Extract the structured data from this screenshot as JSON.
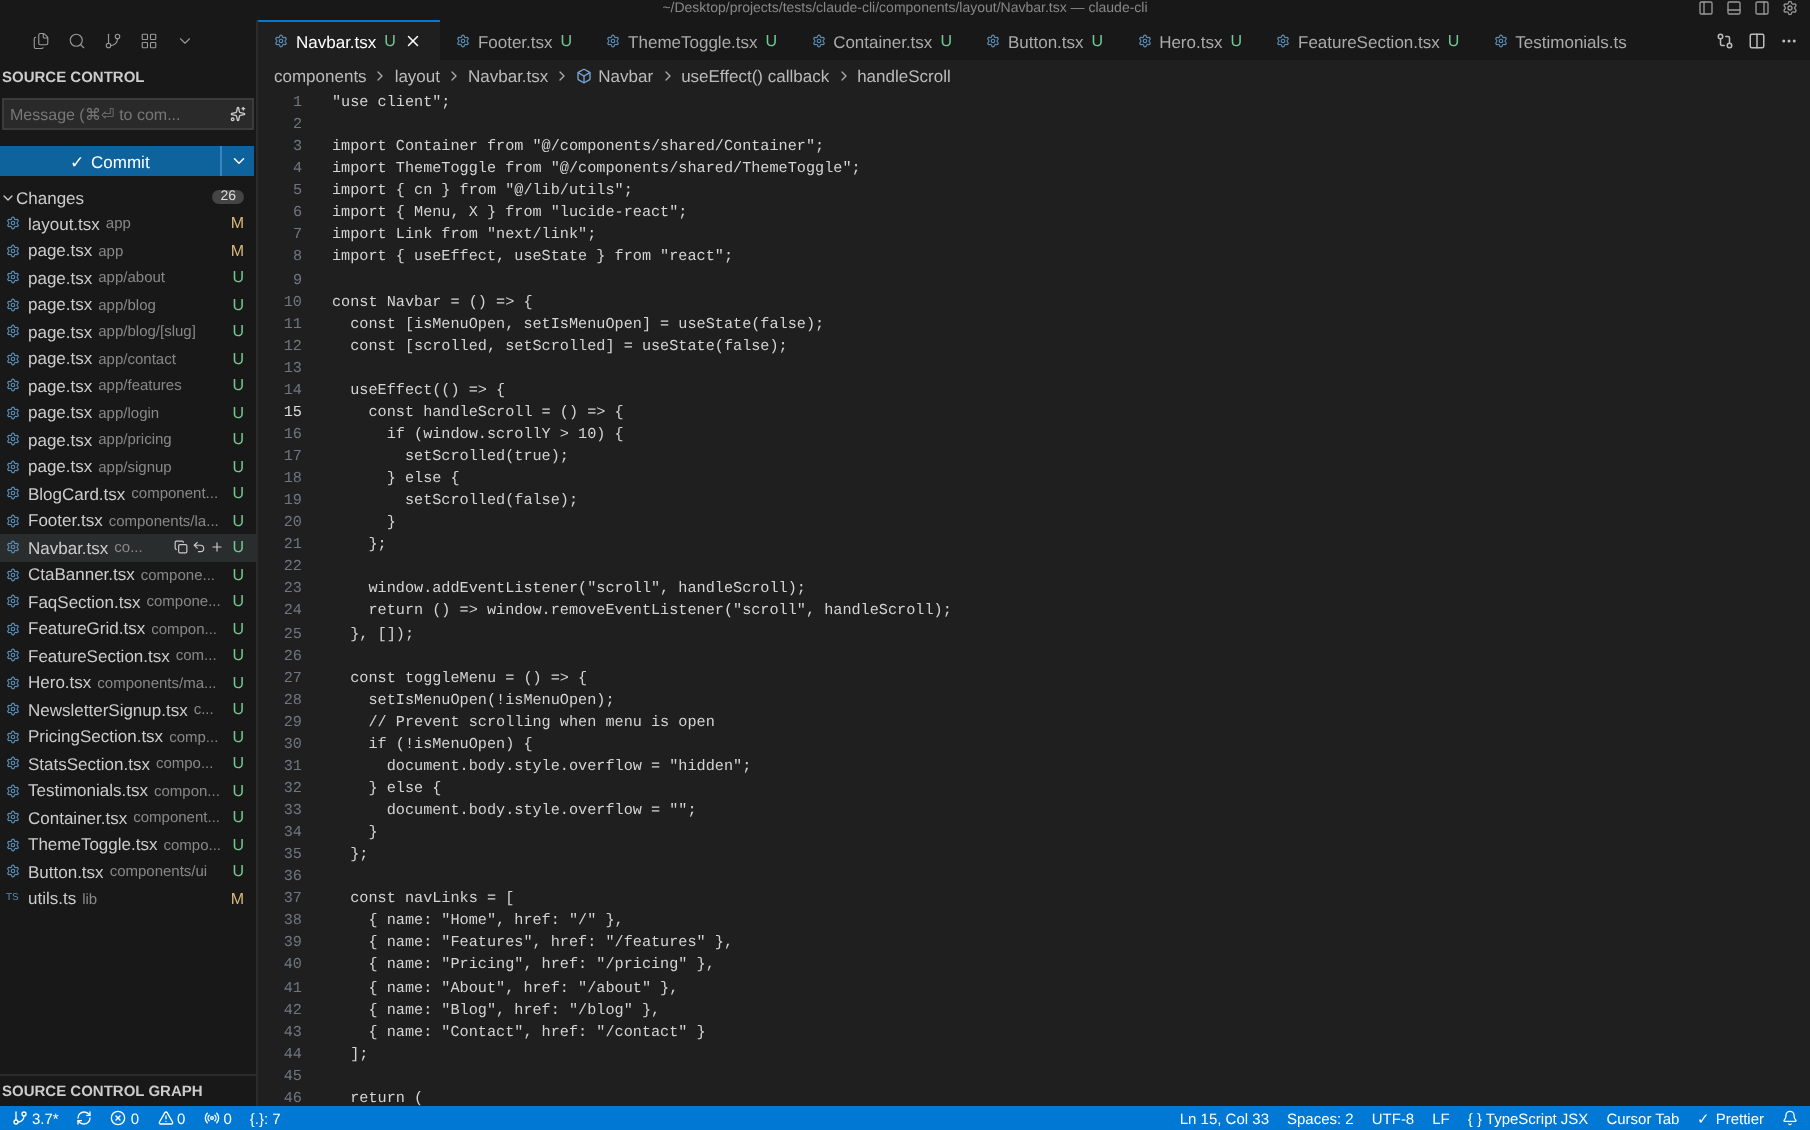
{
  "window": {
    "title": "~/Desktop/projects/tests/claude-cli/components/layout/Navbar.tsx — claude-cli"
  },
  "sidebar": {
    "title": "SOURCE CONTROL",
    "message": {
      "placeholder": "Message (⌘⏎ to com..."
    },
    "commit": "✓ Commit",
    "changes": {
      "label": "Changes",
      "count": "26",
      "expanded": true
    },
    "files": [
      {
        "name": "layout.tsx",
        "path": "app",
        "status": "M",
        "selected": false
      },
      {
        "name": "page.tsx",
        "path": "app",
        "status": "M",
        "selected": false
      },
      {
        "name": "page.tsx",
        "path": "app/about",
        "status": "U",
        "selected": false
      },
      {
        "name": "page.tsx",
        "path": "app/blog",
        "status": "U",
        "selected": false
      },
      {
        "name": "page.tsx",
        "path": "app/blog/[slug]",
        "status": "U",
        "selected": false
      },
      {
        "name": "page.tsx",
        "path": "app/contact",
        "status": "U",
        "selected": false
      },
      {
        "name": "page.tsx",
        "path": "app/features",
        "status": "U",
        "selected": false
      },
      {
        "name": "page.tsx",
        "path": "app/login",
        "status": "U",
        "selected": false
      },
      {
        "name": "page.tsx",
        "path": "app/pricing",
        "status": "U",
        "selected": false
      },
      {
        "name": "page.tsx",
        "path": "app/signup",
        "status": "U",
        "selected": false
      },
      {
        "name": "BlogCard.tsx",
        "path": "component...",
        "status": "U",
        "selected": false
      },
      {
        "name": "Footer.tsx",
        "path": "components/la...",
        "status": "U",
        "selected": false
      },
      {
        "name": "Navbar.tsx",
        "path": "co...",
        "status": "U",
        "selected": true
      },
      {
        "name": "CtaBanner.tsx",
        "path": "compone...",
        "status": "U",
        "selected": false
      },
      {
        "name": "FaqSection.tsx",
        "path": "compone...",
        "status": "U",
        "selected": false
      },
      {
        "name": "FeatureGrid.tsx",
        "path": "compon...",
        "status": "U",
        "selected": false
      },
      {
        "name": "FeatureSection.tsx",
        "path": "com...",
        "status": "U",
        "selected": false
      },
      {
        "name": "Hero.tsx",
        "path": "components/ma...",
        "status": "U",
        "selected": false
      },
      {
        "name": "NewsletterSignup.tsx",
        "path": "c...",
        "status": "U",
        "selected": false
      },
      {
        "name": "PricingSection.tsx",
        "path": "comp...",
        "status": "U",
        "selected": false
      },
      {
        "name": "StatsSection.tsx",
        "path": "compo...",
        "status": "U",
        "selected": false
      },
      {
        "name": "Testimonials.tsx",
        "path": "compon...",
        "status": "U",
        "selected": false
      },
      {
        "name": "Container.tsx",
        "path": "component...",
        "status": "U",
        "selected": false
      },
      {
        "name": "ThemeToggle.tsx",
        "path": "compo...",
        "status": "U",
        "selected": false
      },
      {
        "name": "Button.tsx",
        "path": "components/ui",
        "status": "U",
        "selected": false
      },
      {
        "name": "utils.ts",
        "path": "lib",
        "status": "M",
        "selected": false,
        "badge": "TS"
      }
    ],
    "graph_title": "SOURCE CONTROL GRAPH"
  },
  "tabs": [
    {
      "label": "Navbar.tsx",
      "status": "U",
      "selected": true
    },
    {
      "label": "Footer.tsx",
      "status": "U",
      "selected": false
    },
    {
      "label": "ThemeToggle.tsx",
      "status": "U",
      "selected": false
    },
    {
      "label": "Container.tsx",
      "status": "U",
      "selected": false
    },
    {
      "label": "Button.tsx",
      "status": "U",
      "selected": false
    },
    {
      "label": "Hero.tsx",
      "status": "U",
      "selected": false
    },
    {
      "label": "FeatureSection.tsx",
      "status": "U",
      "selected": false
    },
    {
      "label": "Testimonials.ts",
      "selected": false
    }
  ],
  "breadcrumbs": [
    "components",
    "layout",
    "Navbar.tsx",
    "Navbar",
    "useEffect() callback",
    "handleScroll"
  ],
  "editor": {
    "lines": [
      {
        "number": "1",
        "current": false,
        "text": "\"use client\";"
      },
      {
        "number": "2",
        "current": false
      },
      {
        "number": "3",
        "current": false,
        "text": "import Container from \"@/components/shared/Container\";"
      },
      {
        "number": "4",
        "current": false,
        "text": "import ThemeToggle from \"@/components/shared/ThemeToggle\";"
      },
      {
        "number": "5",
        "current": false,
        "text": "import { cn } from \"@/lib/utils\";"
      },
      {
        "number": "6",
        "current": false,
        "text": "import { Menu, X } from \"lucide-react\";"
      },
      {
        "number": "7",
        "current": false,
        "text": "import Link from \"next/link\";"
      },
      {
        "number": "8",
        "current": false,
        "text": "import { useEffect, useState } from \"react\";"
      },
      {
        "number": "9",
        "current": false
      },
      {
        "number": "10",
        "current": false,
        "text": "const Navbar = () => {"
      },
      {
        "number": "11",
        "current": false,
        "text": "  const [isMenuOpen, setIsMenuOpen] = useState(false);"
      },
      {
        "number": "12",
        "current": false,
        "text": "  const [scrolled, setScrolled] = useState(false);"
      },
      {
        "number": "13",
        "current": false
      },
      {
        "number": "14",
        "current": false,
        "text": "  useEffect(() => {"
      },
      {
        "number": "15",
        "current": true,
        "text": "    const handleScroll = () => {"
      },
      {
        "number": "16",
        "current": false,
        "text": "      if (window.scrollY > 10) {"
      },
      {
        "number": "17",
        "current": false,
        "text": "        setScrolled(true);"
      },
      {
        "number": "18",
        "current": false,
        "text": "      } else {"
      },
      {
        "number": "19",
        "current": false,
        "text": "        setScrolled(false);"
      },
      {
        "number": "20",
        "current": false,
        "text": "      }"
      },
      {
        "number": "21",
        "current": false,
        "text": "    };"
      },
      {
        "number": "22",
        "current": false
      },
      {
        "number": "23",
        "current": false,
        "text": "    window.addEventListener(\"scroll\", handleScroll);"
      },
      {
        "number": "24",
        "current": false,
        "text": "    return () => window.removeEventListener(\"scroll\", handleScroll);"
      },
      {
        "number": "25",
        "current": false,
        "text": "  }, []);"
      },
      {
        "number": "26",
        "current": false
      },
      {
        "number": "27",
        "current": false,
        "text": "  const toggleMenu = () => {"
      },
      {
        "number": "28",
        "current": false,
        "text": "    setIsMenuOpen(!isMenuOpen);"
      },
      {
        "number": "29",
        "current": false,
        "text": "    // Prevent scrolling when menu is open"
      },
      {
        "number": "30",
        "current": false,
        "text": "    if (!isMenuOpen) {"
      },
      {
        "number": "31",
        "current": false,
        "text": "      document.body.style.overflow = \"hidden\";"
      },
      {
        "number": "32",
        "current": false,
        "text": "    } else {"
      },
      {
        "number": "33",
        "current": false,
        "text": "      document.body.style.overflow = \"\";"
      },
      {
        "number": "34",
        "current": false,
        "text": "    }"
      },
      {
        "number": "35",
        "current": false,
        "text": "  };"
      },
      {
        "number": "36",
        "current": false
      },
      {
        "number": "37",
        "current": false,
        "text": "  const navLinks = ["
      },
      {
        "number": "38",
        "current": false,
        "text": "    { name: \"Home\", href: \"/\" },"
      },
      {
        "number": "39",
        "current": false,
        "text": "    { name: \"Features\", href: \"/features\" },"
      },
      {
        "number": "40",
        "current": false,
        "text": "    { name: \"Pricing\", href: \"/pricing\" },"
      },
      {
        "number": "41",
        "current": false,
        "text": "    { name: \"About\", href: \"/about\" },"
      },
      {
        "number": "42",
        "current": false,
        "text": "    { name: \"Blog\", href: \"/blog\" },"
      },
      {
        "number": "43",
        "current": false,
        "text": "    { name: \"Contact\", href: \"/contact\" }"
      },
      {
        "number": "44",
        "current": false,
        "text": "  ];"
      },
      {
        "number": "45",
        "current": false
      },
      {
        "number": "46",
        "current": false,
        "text": "  return ("
      }
    ]
  },
  "status_bar": {
    "left": [
      {
        "kind": "branch",
        "text": "3.7*"
      },
      {
        "kind": "sync"
      },
      {
        "kind": "errors",
        "text": "0"
      },
      {
        "kind": "warnings",
        "text": "0"
      },
      {
        "kind": "ports",
        "text": "0"
      },
      {
        "kind": "plain",
        "text": "{.}: 7"
      }
    ],
    "right": [
      "Ln 15, Col 33",
      "Spaces: 2",
      "UTF-8",
      "LF",
      "{ } TypeScript JSX",
      "Cursor Tab",
      "✓ Prettier"
    ]
  }
}
